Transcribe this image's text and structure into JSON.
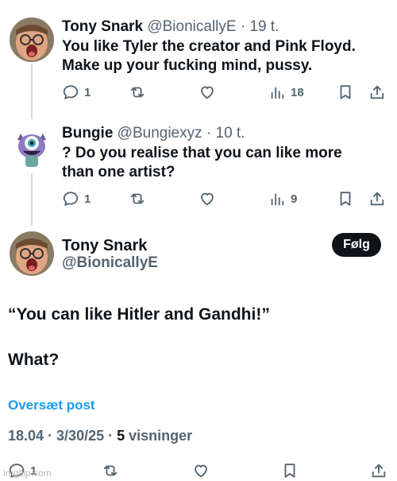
{
  "tweets": [
    {
      "author": "Tony Snark",
      "handle": "@BionicallyE",
      "time": "· 19 t.",
      "text_lines": [
        "You like Tyler the creator and Pink Floyd.",
        "Make up your fucking mind, pussy."
      ],
      "replies": "1",
      "views": "18"
    },
    {
      "author": "Bungie",
      "handle": "@Bungiexyz",
      "time": "· 10 t.",
      "text_lines": [
        "? Do you realise that you can like more",
        "than one artist?"
      ],
      "replies": "1",
      "views": "9"
    }
  ],
  "main_post": {
    "author": "Tony Snark",
    "handle": "@BionicallyE",
    "follow_label": "Følg",
    "text_lines": [
      "“You can like Hitler and Gandhi!”",
      "What?"
    ],
    "translate_label": "Oversæt post",
    "timestamp": "18.04 · 3/30/25 · ",
    "views_count": "5",
    "views_label": " visninger",
    "replies": "1"
  },
  "watermark": "imgflip.com",
  "colors": {
    "text": "#0f1419",
    "secondary": "#536471",
    "link": "#1d9bf0",
    "thread_line": "#cfd9de"
  }
}
